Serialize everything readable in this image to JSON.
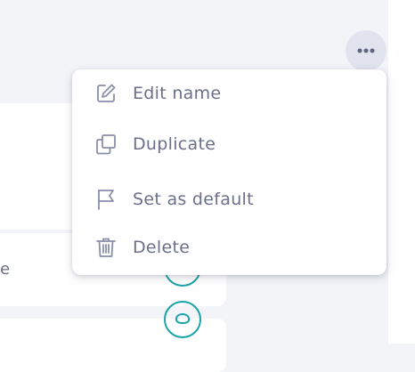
{
  "menu": {
    "items": [
      {
        "label": "Edit name",
        "icon": "edit-icon"
      },
      {
        "label": "Duplicate",
        "icon": "duplicate-icon"
      },
      {
        "label": "Set as default",
        "icon": "flag-icon"
      },
      {
        "label": "Delete",
        "icon": "trash-icon"
      }
    ]
  },
  "more_button": {
    "icon": "more-horizontal-icon"
  },
  "list": {
    "card_text_fragment": "e"
  },
  "colors": {
    "menu_text": "#6b6f8a",
    "icon_stroke": "#8a8fa8",
    "accent_teal": "#1aa3a9",
    "background": "#f3f4f8",
    "more_button_bg": "#e1e3ee"
  }
}
